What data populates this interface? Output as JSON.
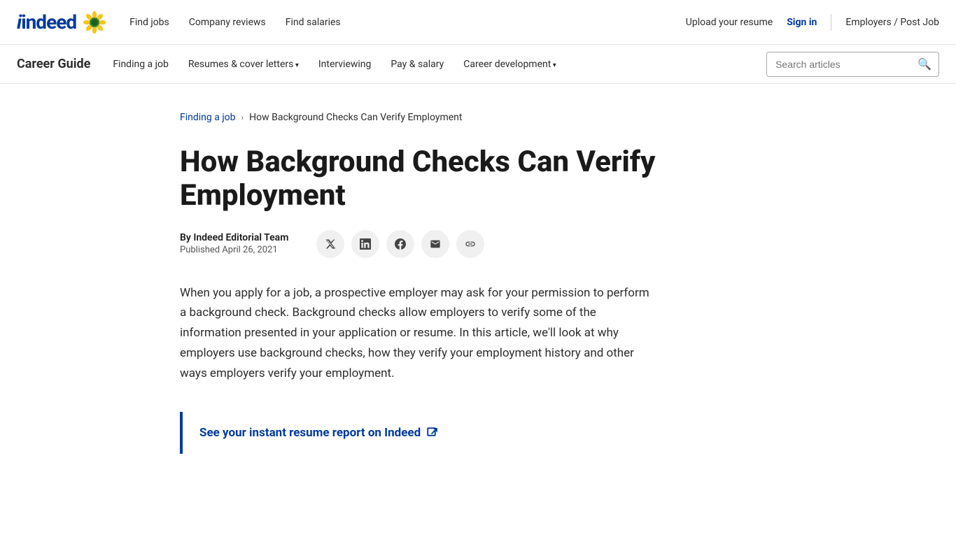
{
  "top_nav": {
    "logo": "indeed",
    "links": [
      {
        "label": "Find jobs",
        "href": "#"
      },
      {
        "label": "Company reviews",
        "href": "#"
      },
      {
        "label": "Find salaries",
        "href": "#"
      }
    ],
    "right": {
      "upload_resume": "Upload your resume",
      "sign_in": "Sign in",
      "employers": "Employers / Post Job"
    }
  },
  "career_nav": {
    "title": "Career Guide",
    "links": [
      {
        "label": "Finding a job",
        "href": "#",
        "dropdown": false
      },
      {
        "label": "Resumes & cover letters",
        "href": "#",
        "dropdown": true
      },
      {
        "label": "Interviewing",
        "href": "#",
        "dropdown": false
      },
      {
        "label": "Pay & salary",
        "href": "#",
        "dropdown": false
      },
      {
        "label": "Career development",
        "href": "#",
        "dropdown": true
      }
    ],
    "search": {
      "placeholder": "Search articles"
    }
  },
  "breadcrumb": {
    "parent": "Finding a job",
    "current": "How Background Checks Can Verify Employment",
    "arrow": "›"
  },
  "article": {
    "title": "How Background Checks Can Verify Employment",
    "author": "By Indeed Editorial Team",
    "published": "Published April 26, 2021",
    "body": "When you apply for a job, a prospective employer may ask for your permission to perform a background check. Background checks allow employers to verify some of the information presented in your application or resume. In this article, we'll look at why employers use background checks, how they verify your employment history and other ways employers verify your employment.",
    "cta_text": "See your instant resume report on Indeed",
    "share_buttons": [
      {
        "name": "twitter",
        "symbol": "𝕏"
      },
      {
        "name": "linkedin",
        "symbol": "in"
      },
      {
        "name": "facebook",
        "symbol": "f"
      },
      {
        "name": "email",
        "symbol": "✉"
      },
      {
        "name": "link",
        "symbol": "🔗"
      }
    ]
  },
  "colors": {
    "brand_blue": "#003A9B",
    "text_dark": "#1a1a1a",
    "text_mid": "#2d2d2d",
    "border_light": "#e5e5e5",
    "cta_border": "#003A9B"
  }
}
